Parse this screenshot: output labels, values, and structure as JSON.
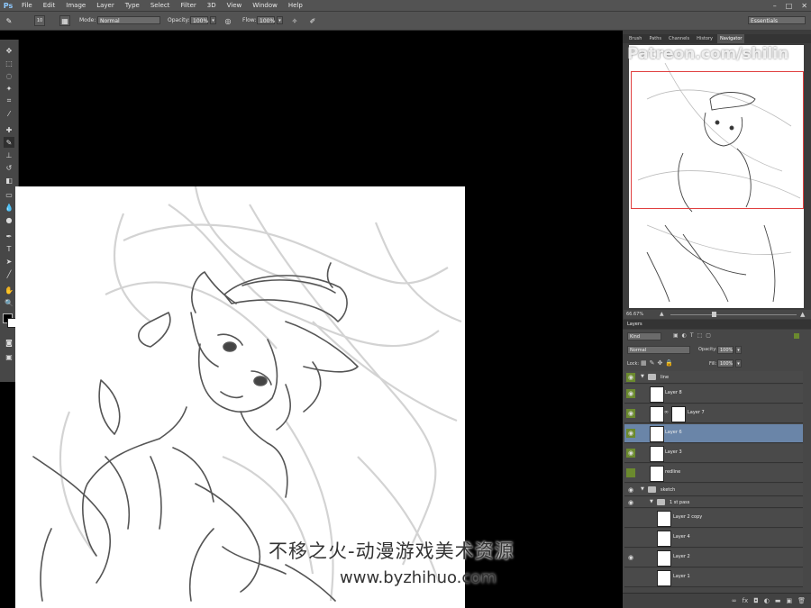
{
  "app": {
    "logo": "Ps"
  },
  "menu": [
    "File",
    "Edit",
    "Image",
    "Layer",
    "Type",
    "Select",
    "Filter",
    "3D",
    "View",
    "Window",
    "Help"
  ],
  "window_controls": {
    "minimize": "–",
    "maximize": "□",
    "close": "✕"
  },
  "options": {
    "mode_label": "Mode:",
    "mode_value": "Normal",
    "opacity_label": "Opacity:",
    "opacity_value": "100%",
    "flow_label": "Flow:",
    "flow_value": "100%",
    "brush_size": "10",
    "workspace": "Essentials"
  },
  "panel_tabs": [
    "Brush",
    "Paths",
    "Channels",
    "History",
    "Navigator"
  ],
  "navigator": {
    "zoom": "66.67%",
    "watermark": "Patreon.com/shilin"
  },
  "layers": {
    "title": "Layers",
    "filter_kind": "Kind",
    "blend_mode": "Normal",
    "opacity_label": "Opacity:",
    "opacity_value": "100%",
    "lock_label": "Lock:",
    "fill_label": "Fill:",
    "fill_value": "100%",
    "rows": [
      {
        "name": "line",
        "kind": "group"
      },
      {
        "name": "Layer 8",
        "kind": "layer"
      },
      {
        "name": "Layer 7",
        "kind": "layer"
      },
      {
        "name": "Layer 6",
        "kind": "layer",
        "selected": true
      },
      {
        "name": "Layer 3",
        "kind": "layer"
      },
      {
        "name": "redline",
        "kind": "layer"
      },
      {
        "name": "sketch",
        "kind": "group"
      },
      {
        "name": "1 st pass",
        "kind": "group"
      },
      {
        "name": "Layer 2 copy",
        "kind": "layer"
      },
      {
        "name": "Layer 4",
        "kind": "layer"
      },
      {
        "name": "Layer 2",
        "kind": "layer"
      },
      {
        "name": "Layer 1",
        "kind": "layer"
      }
    ]
  },
  "overlay": {
    "cn": "不移之火-动漫游戏美术资源",
    "url": "www.byzhihuo.com"
  },
  "colors": {
    "ui_dark": "#535353",
    "panel": "#474747",
    "selected_layer": "#6a85a8",
    "nav_frame": "#e04040",
    "visibility_green": "#6b8a2e"
  }
}
